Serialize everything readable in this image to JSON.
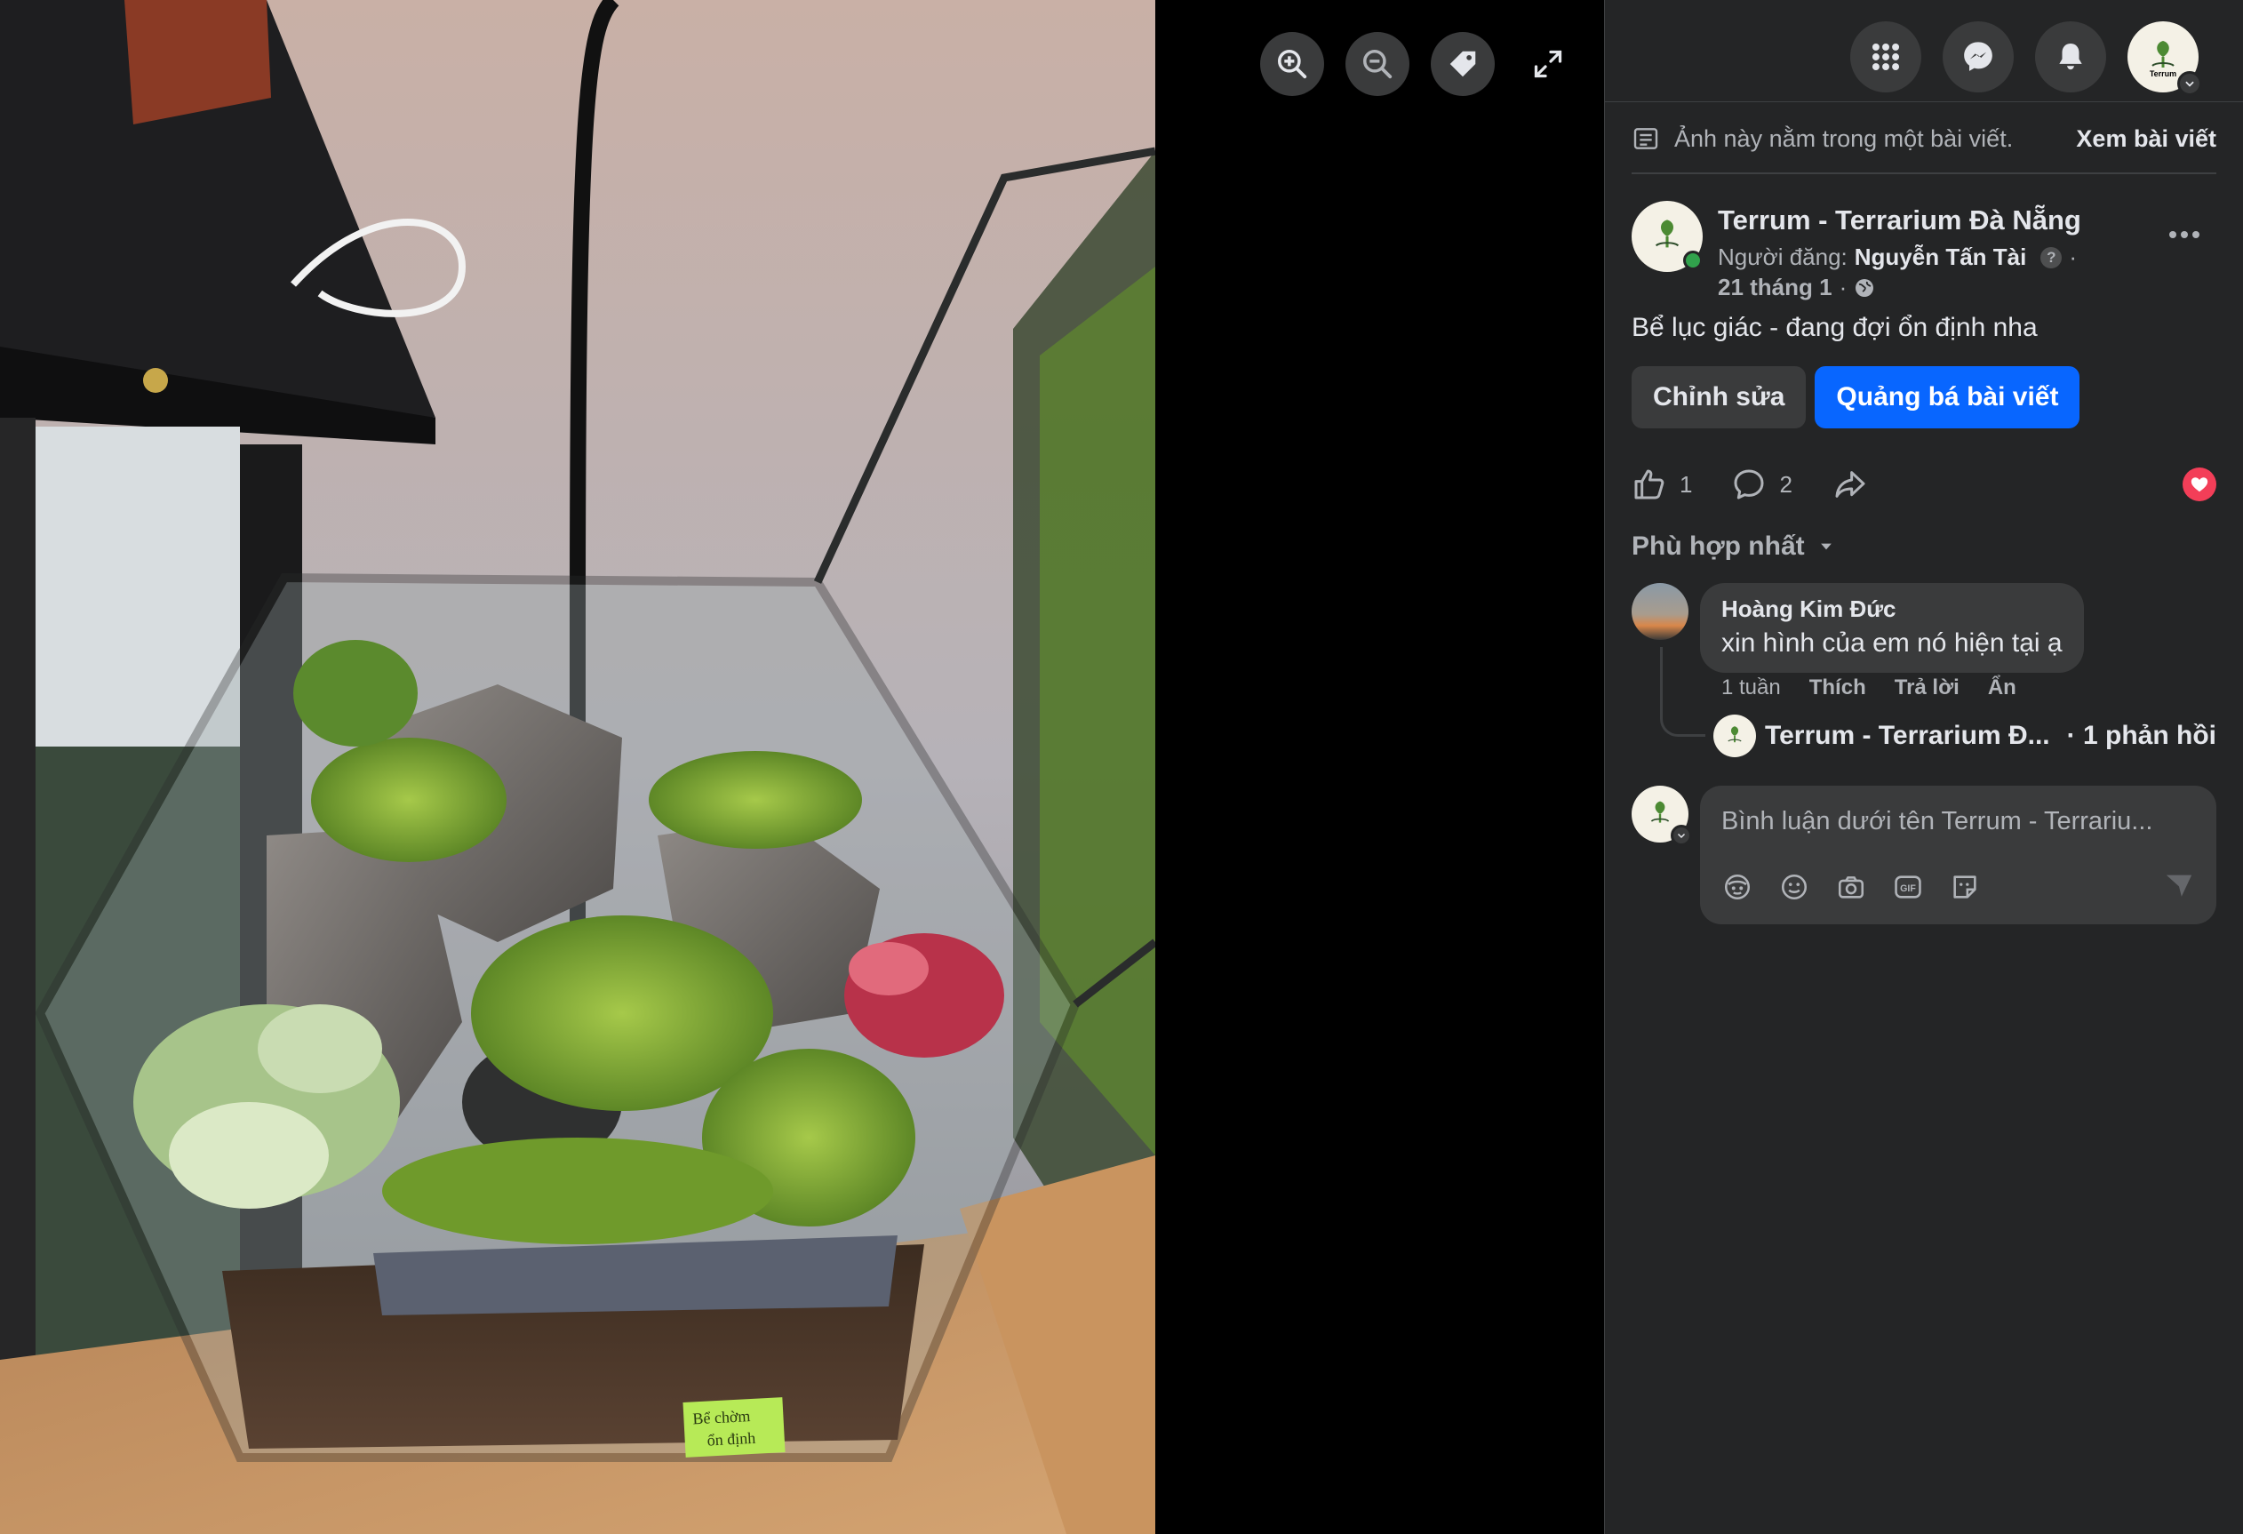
{
  "viewer": {
    "tools": [
      "zoom-in-icon",
      "zoom-out-icon",
      "tag-icon",
      "fullscreen-icon"
    ]
  },
  "photo": {
    "note_label": "Bể chờm ổn định"
  },
  "topbar": {
    "icons": [
      "menu-grid-icon",
      "messenger-icon",
      "bell-icon"
    ],
    "avatar_text": "Terrum"
  },
  "notice": {
    "text": "Ảnh này nằm trong một bài viết.",
    "link": "Xem bài viết"
  },
  "post": {
    "page_name": "Terrum - Terrarium Đà Nẵng",
    "poster_prefix": "Người đăng:",
    "poster_name": "Nguyễn Tấn Tài",
    "poster_suffix": "·",
    "date": "21 tháng 1",
    "date_sep": "·",
    "text": "Bể lục giác - đang đợi ổn định nha",
    "edit_label": "Chỉnh sửa",
    "boost_label": "Quảng bá bài viết",
    "like_count": "1",
    "comment_count": "2"
  },
  "comments": {
    "sort_label": "Phù hợp nhất",
    "items": [
      {
        "author": "Hoàng Kim Đức",
        "text": "xin hình của em nó hiện tại ạ",
        "time": "1 tuần",
        "like": "Thích",
        "reply": "Trả lời",
        "hide": "Ẩn",
        "reply_author": "Terrum - Terrarium Đ...",
        "reply_count": "· 1 phản hồi"
      }
    ]
  },
  "composer": {
    "placeholder": "Bình luận dưới tên Terrum - Terrariu...",
    "tools": [
      "avatar-sticker-icon",
      "emoji-icon",
      "camera-icon",
      "gif-icon",
      "sticker-icon"
    ]
  },
  "colors": {
    "sidebar_bg": "#242526",
    "surface": "#3a3b3c",
    "text_primary": "#e4e6eb",
    "text_secondary": "#b0b3b8",
    "primary_blue": "#0866ff",
    "online_green": "#31a24c",
    "love_red": "#f33e58"
  }
}
